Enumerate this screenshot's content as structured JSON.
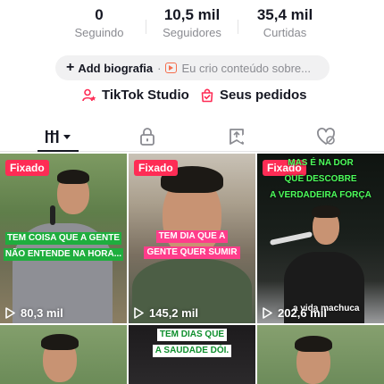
{
  "stats": {
    "following": {
      "value": "0",
      "label": "Seguindo"
    },
    "followers": {
      "value": "10,5 mil",
      "label": "Seguidores"
    },
    "likes": {
      "value": "35,4 mil",
      "label": "Curtidas"
    }
  },
  "bio": {
    "add_label": "Add biografia",
    "separator": "·",
    "text": "Eu crio conteúdo sobre..."
  },
  "links": {
    "studio": "TikTok Studio",
    "orders": "Seus pedidos"
  },
  "tabs": [
    "videos",
    "private",
    "reposts",
    "liked"
  ],
  "colors": {
    "accent": "#fe2c55",
    "text": "#161823",
    "muted": "#8a8b91"
  },
  "videos": [
    {
      "pinned": "Fixado",
      "views": "80,3 mil",
      "caption": [
        "TEM COISA QUE A GENTE",
        "NÃO ENTENDE NA HORA..."
      ]
    },
    {
      "pinned": "Fixado",
      "views": "145,2 mil",
      "caption": [
        "TEM DIA QUE A",
        "GENTE QUER SUMIR"
      ]
    },
    {
      "pinned": "Fixado",
      "views": "202,6 mil",
      "caption": [
        "MAS É NA DOR",
        "QUE DESCOBRE",
        "A VERDADEIRA FORÇA"
      ],
      "subcaption": "a vida machuca"
    },
    {
      "caption": []
    },
    {
      "caption": [
        "TEM DIAS QUE",
        "A SAUDADE DÓI."
      ]
    },
    {
      "caption": []
    }
  ]
}
